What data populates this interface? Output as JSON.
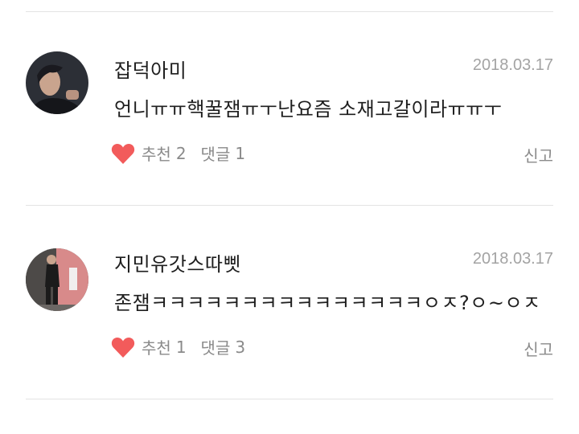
{
  "comments": [
    {
      "username": "잡덕아미",
      "date": "2018.03.17",
      "text": "언니ㅠㅠ핵꿀잼ㅠㅜ난요즘 소재고갈이라ㅠㅠㅜ",
      "like_label": "추천",
      "like_count": "2",
      "reply_label": "댓글",
      "reply_count": "1",
      "report_label": "신고"
    },
    {
      "username": "지민유갓스따삣",
      "date": "2018.03.17",
      "text": "존잼ㅋㅋㅋㅋㅋㅋㅋㅋㅋㅋㅋㅋㅋㅋㅋㅇㅈ?ㅇ~ㅇㅈ",
      "like_label": "추천",
      "like_count": "1",
      "reply_label": "댓글",
      "reply_count": "3",
      "report_label": "신고"
    }
  ],
  "colors": {
    "heart": "#f25b5b",
    "divider": "#e3e3e3",
    "date": "#a3a3a3",
    "meta": "#8a8a8a"
  },
  "icons": {
    "like": "heart-icon"
  }
}
